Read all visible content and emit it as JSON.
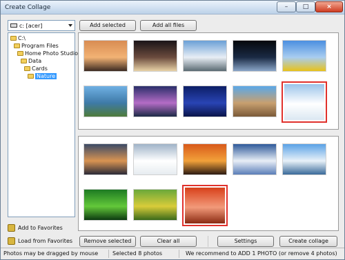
{
  "window": {
    "title": "Create Collage",
    "minimize_glyph": "–",
    "maximize_glyph": "□",
    "close_glyph": "×"
  },
  "drive_selector": {
    "value": "c: [acer]",
    "icon": "drive-icon"
  },
  "toolbar": {
    "add_selected": "Add selected",
    "add_all_files": "Add all files"
  },
  "folder_tree": [
    {
      "label": "C:\\",
      "depth": 0,
      "selected": false
    },
    {
      "label": "Program Files",
      "depth": 1,
      "selected": false
    },
    {
      "label": "Home Photo Studio",
      "depth": 2,
      "selected": false
    },
    {
      "label": "Data",
      "depth": 3,
      "selected": false
    },
    {
      "label": "Cards",
      "depth": 4,
      "selected": false
    },
    {
      "label": "Nature",
      "depth": 5,
      "selected": true
    }
  ],
  "sidebar": {
    "add_to_favorites": "Add to Favorites",
    "load_from_favorites": "Load from Favorites"
  },
  "source_photos": [
    {
      "name": "sunset-boat",
      "colors": [
        "#d88c52",
        "#f2b274",
        "#3b2a22"
      ],
      "highlighted": false
    },
    {
      "name": "galaxy",
      "colors": [
        "#1a1417",
        "#6b4b3d",
        "#e8d2a6"
      ],
      "highlighted": false
    },
    {
      "name": "snow-mountains",
      "colors": [
        "#6aa0d6",
        "#e8eef5",
        "#5a6a72"
      ],
      "highlighted": false
    },
    {
      "name": "earth-space",
      "colors": [
        "#05080c",
        "#1a2a44",
        "#8aa6c8"
      ],
      "highlighted": false
    },
    {
      "name": "sunflowers",
      "colors": [
        "#4b8fe0",
        "#a9cdf0",
        "#e8c21a"
      ],
      "highlighted": false
    },
    {
      "name": "lighthouse-coast",
      "colors": [
        "#6fb0e3",
        "#3e7aa8",
        "#4e7b3a"
      ],
      "highlighted": false
    },
    {
      "name": "aurora-reflection",
      "colors": [
        "#2a2f6a",
        "#b46cc6",
        "#1c2a46"
      ],
      "highlighted": false
    },
    {
      "name": "starfield",
      "colors": [
        "#0c1e66",
        "#2944b4",
        "#0a144a"
      ],
      "highlighted": false
    },
    {
      "name": "rocky-beach",
      "colors": [
        "#5aa8e8",
        "#c8a070",
        "#7a5a38"
      ],
      "highlighted": false
    },
    {
      "name": "winter-trees",
      "colors": [
        "#9bc4ea",
        "#ffffff",
        "#dbe8f2"
      ],
      "highlighted": true
    }
  ],
  "selected_photos": [
    {
      "name": "sea-sunset",
      "colors": [
        "#3b4a66",
        "#d99452",
        "#2a2a38"
      ],
      "highlighted": false
    },
    {
      "name": "snow-tree",
      "colors": [
        "#9fb3c8",
        "#ffffff",
        "#e6ecf0"
      ],
      "highlighted": false
    },
    {
      "name": "red-sunset",
      "colors": [
        "#d85a1a",
        "#f2a13a",
        "#2c1a12"
      ],
      "highlighted": false
    },
    {
      "name": "clouds",
      "colors": [
        "#2f5a9a",
        "#e8eef6",
        "#5a7eb8"
      ],
      "highlighted": false
    },
    {
      "name": "bay-shore",
      "colors": [
        "#5aa2e6",
        "#e8f1f8",
        "#3a6a9a"
      ],
      "highlighted": false
    },
    {
      "name": "green-leaf",
      "colors": [
        "#1d7a22",
        "#63c83a",
        "#0c3a10"
      ],
      "highlighted": false
    },
    {
      "name": "rapeseed-field",
      "colors": [
        "#6aa83a",
        "#d8cc3a",
        "#3a6a1a"
      ],
      "highlighted": false
    },
    {
      "name": "autumn-red-forest",
      "colors": [
        "#d8401a",
        "#f29a7a",
        "#8a2a12"
      ],
      "highlighted": true
    }
  ],
  "bottom_buttons": {
    "remove_selected": "Remove selected",
    "clear_all": "Clear all",
    "settings": "Settings",
    "create_collage": "Create collage"
  },
  "status": {
    "hint": "Photos may be dragged by mouse",
    "selected_count": "Selected 8 photos",
    "recommendation": "We recommend to ADD 1 PHOTO (or remove 4 photos)"
  }
}
